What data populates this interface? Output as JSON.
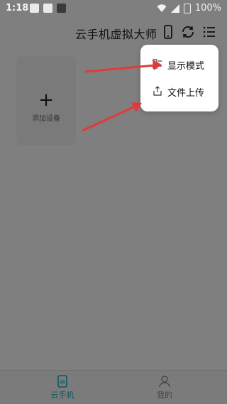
{
  "status_bar": {
    "time": "1:18",
    "battery": "100%",
    "icons": [
      "image-icon",
      "text-a-icon",
      "app-icon",
      "wifi-icon",
      "signal-icon",
      "battery-icon"
    ]
  },
  "header": {
    "title": "云手机虚拟大师",
    "icons": [
      "phone-icon",
      "refresh-icon",
      "list-menu-icon"
    ]
  },
  "add_card": {
    "plus": "+",
    "label": "添加设备"
  },
  "dropdown_menu": {
    "items": [
      {
        "label": "显示模式",
        "icon": "display-mode-icon"
      },
      {
        "label": "文件上传",
        "icon": "upload-icon"
      }
    ]
  },
  "bottom_nav": {
    "items": [
      {
        "label": "云手机",
        "icon": "cloud-phone-icon",
        "active": true
      },
      {
        "label": "我的",
        "icon": "user-icon",
        "active": false
      }
    ]
  },
  "colors": {
    "overlay_bg": "#7f7f7f",
    "menu_bg": "#ffffff",
    "arrow": "#e23a3a",
    "active_tab": "#0d5961"
  }
}
